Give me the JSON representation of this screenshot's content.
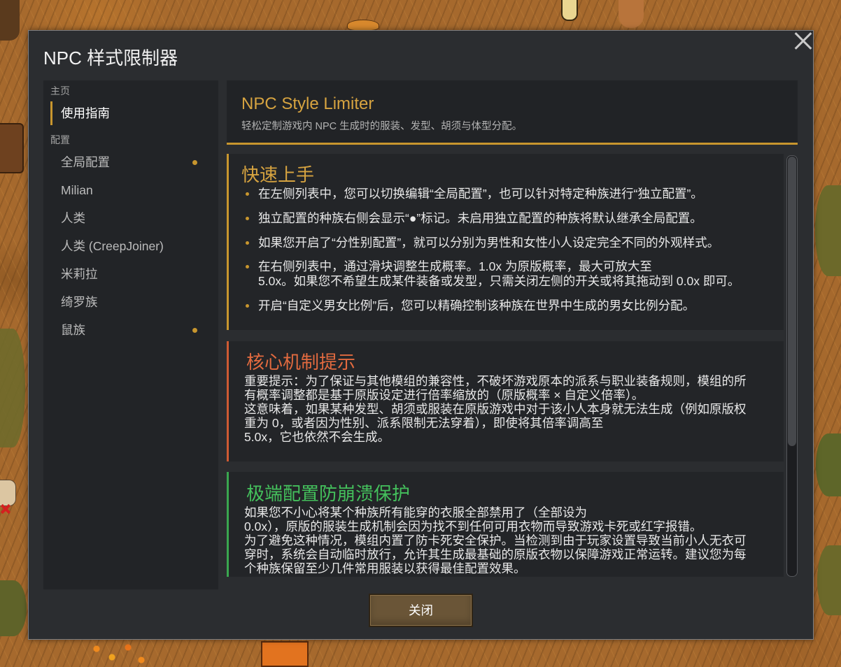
{
  "window": {
    "title": "NPC 样式限制器",
    "close_icon": "close-icon"
  },
  "sidebar": {
    "groups": [
      {
        "header": "主页",
        "items": [
          {
            "label": "使用指南",
            "selected": true,
            "has_override": false
          }
        ]
      },
      {
        "header": "配置",
        "items": [
          {
            "label": "全局配置",
            "selected": false,
            "has_override": true
          },
          {
            "label": "Milian",
            "selected": false,
            "has_override": false
          },
          {
            "label": "人类",
            "selected": false,
            "has_override": false
          },
          {
            "label": "人类 (CreepJoiner)",
            "selected": false,
            "has_override": false
          },
          {
            "label": "米莉拉",
            "selected": false,
            "has_override": false
          },
          {
            "label": "绮罗族",
            "selected": false,
            "has_override": false
          },
          {
            "label": "鼠族",
            "selected": false,
            "has_override": true
          }
        ]
      }
    ]
  },
  "guide": {
    "title": "NPC Style Limiter",
    "subtitle": "轻松定制游戏内 NPC 生成时的服装、发型、胡须与体型分配。",
    "sections": [
      {
        "title": "快速上手",
        "title_color": "#d6a340",
        "accent": "#c8962e",
        "bullets": [
          {
            "lines": [
              "在左侧列表中，您可以切换编辑“全局配置”，也可以针对特定种族进行“独立配置”。"
            ]
          },
          {
            "lines": [
              "独立配置的种族右侧会显示“●”标记。未启用独立配置的种族将默认继承全局配置。"
            ]
          },
          {
            "lines": [
              "如果您开启了“分性别配置”，就可以分别为男性和女性小人设定完全不同的外观样式。"
            ]
          },
          {
            "lines": [
              "在右侧列表中，通过滑块调整生成概率。1.0x 为原版概率，最大可放大至",
              "5.0x。如果您不希望生成某件装备或发型，只需关闭左侧的开关或将其拖动到 0.0x 即可。"
            ]
          },
          {
            "lines": [
              "开启“自定义男女比例”后，您可以精确控制该种族在世界中生成的男女比例分配。"
            ]
          }
        ]
      },
      {
        "title": "核心机制提示",
        "title_color": "#e26a3f",
        "accent": "#cf5a33",
        "lines": [
          "重要提示：为了保证与其他模组的兼容性，不破坏游戏原本的派系与职业装备规则，模组的所",
          "有概率调整都是基于原版设定进行倍率缩放的（原版概率 × 自定义倍率）。",
          "这意味着，如果某种发型、胡须或服装在原版游戏中对于该小人本身就无法生成（例如原版权",
          "重为 0，或者因为性别、派系限制无法穿着），即使将其倍率调高至",
          "5.0x，它也依然不会生成。"
        ]
      },
      {
        "title": "极端配置防崩溃保护",
        "title_color": "#44c05c",
        "accent": "#3aa74f",
        "lines": [
          "如果您不小心将某个种族所有能穿的衣服全部禁用了（全部设为",
          "0.0x），原版的服装生成机制会因为找不到任何可用衣物而导致游戏卡死或红字报错。",
          "为了避免这种情况，模组内置了防卡死安全保护。当检测到由于玩家设置导致当前小人无衣可",
          "穿时，系统会自动临时放行，允许其生成最基础的原版衣物以保障游戏正常运转。建议您为每",
          "个种族保留至少几件常用服装以获得最佳配置效果。"
        ]
      }
    ]
  },
  "footer": {
    "close_label": "关闭"
  }
}
